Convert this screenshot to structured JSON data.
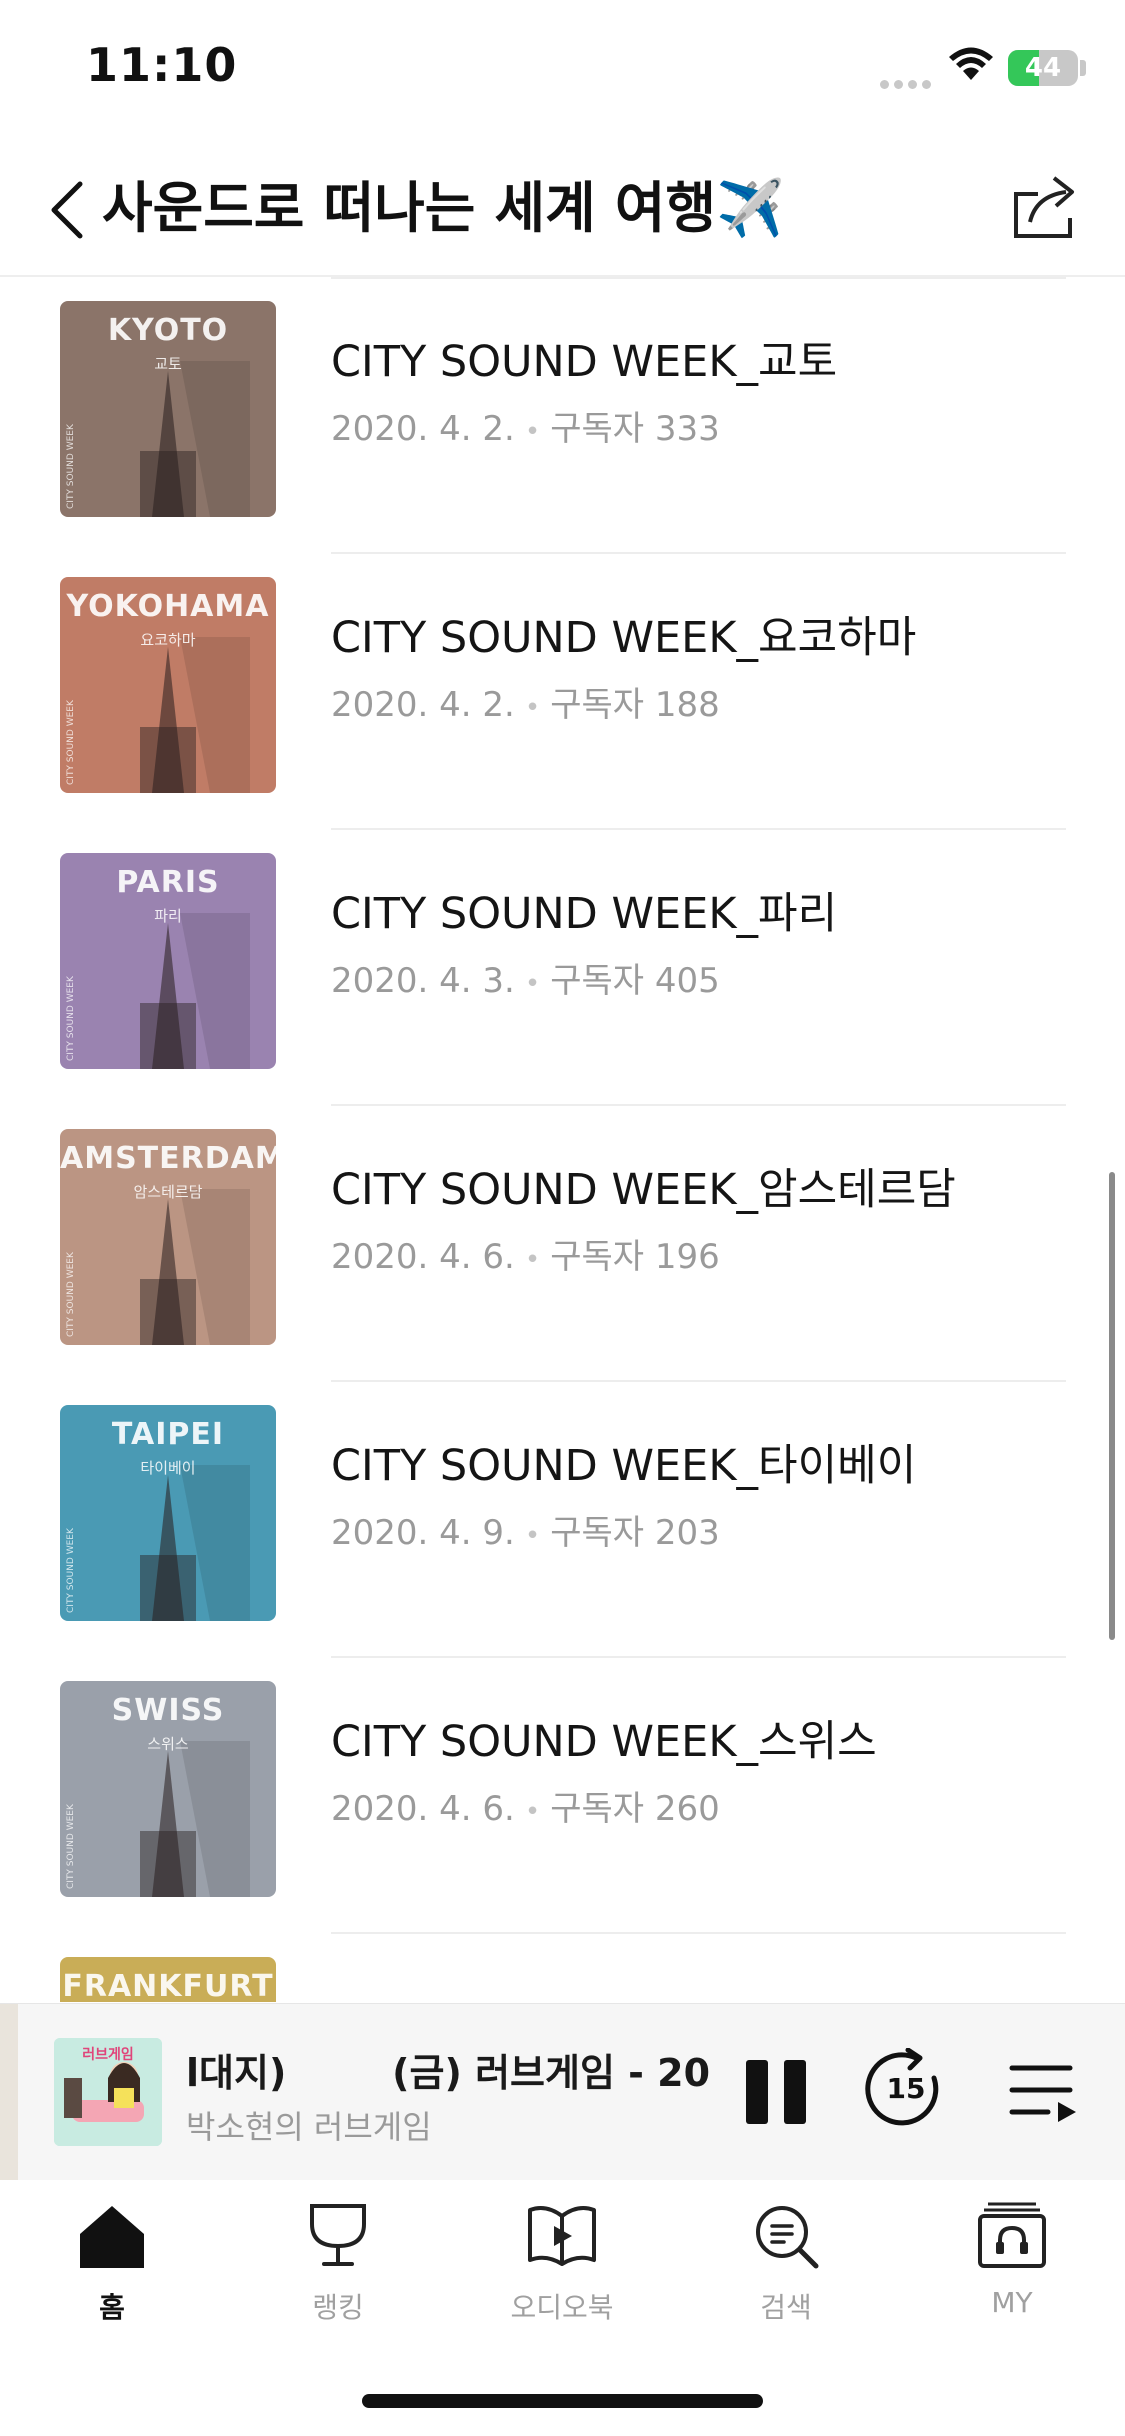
{
  "status_bar": {
    "time": "11:10",
    "battery_level": 44,
    "battery_text": "44"
  },
  "header": {
    "title": "사운드로 떠나는 세계 여행✈️",
    "back_icon": "chevron-left-icon",
    "share_icon": "share-icon"
  },
  "episodes": [
    {
      "title": "CITY SOUND WEEK_교토",
      "date": "2020. 4. 2.",
      "subscribers": "구독자 333",
      "thumb_city_en": "KYOTO",
      "thumb_city_ko": "교토",
      "thumb_color": "#8b7469"
    },
    {
      "title": "CITY SOUND WEEK_요코하마",
      "date": "2020. 4. 2.",
      "subscribers": "구독자 188",
      "thumb_city_en": "YOKOHAMA",
      "thumb_city_ko": "요코하마",
      "thumb_color": "#c07c66"
    },
    {
      "title": "CITY SOUND WEEK_파리",
      "date": "2020. 4. 3.",
      "subscribers": "구독자 405",
      "thumb_city_en": "PARIS",
      "thumb_city_ko": "파리",
      "thumb_color": "#9a83b0"
    },
    {
      "title": "CITY SOUND WEEK_암스테르담",
      "date": "2020. 4. 6.",
      "subscribers": "구독자 196",
      "thumb_city_en": "AMSTERDAM",
      "thumb_city_ko": "암스테르담",
      "thumb_color": "#bb9583"
    },
    {
      "title": "CITY SOUND WEEK_타이베이",
      "date": "2020. 4. 9.",
      "subscribers": "구독자 203",
      "thumb_city_en": "TAIPEI",
      "thumb_city_ko": "타이베이",
      "thumb_color": "#4a9ab4"
    },
    {
      "title": "CITY SOUND WEEK_스위스",
      "date": "2020. 4. 6.",
      "subscribers": "구독자 260",
      "thumb_city_en": "SWISS",
      "thumb_city_ko": "스위스",
      "thumb_color": "#9aa0aa"
    },
    {
      "title": "",
      "date": "",
      "subscribers": "",
      "thumb_city_en": "FRANKFURT",
      "thumb_city_ko": "",
      "thumb_color": "#c9ad57"
    }
  ],
  "thumb_side_text": "CITY SOUND WEEK",
  "player": {
    "title": "l대지)        (금) 러브게임 - 20",
    "subtitle": "박소현의 러브게임",
    "thumb_label": "러브게임",
    "icons": [
      "pause-icon",
      "skip-forward-15-icon",
      "queue-icon"
    ],
    "skip_label": "15"
  },
  "tabs": [
    {
      "label": "홈",
      "icon": "home-icon",
      "active": true
    },
    {
      "label": "랭킹",
      "icon": "trophy-icon",
      "active": false
    },
    {
      "label": "오디오북",
      "icon": "audiobook-icon",
      "active": false
    },
    {
      "label": "검색",
      "icon": "search-icon",
      "active": false
    },
    {
      "label": "MY",
      "icon": "my-library-icon",
      "active": false
    }
  ]
}
